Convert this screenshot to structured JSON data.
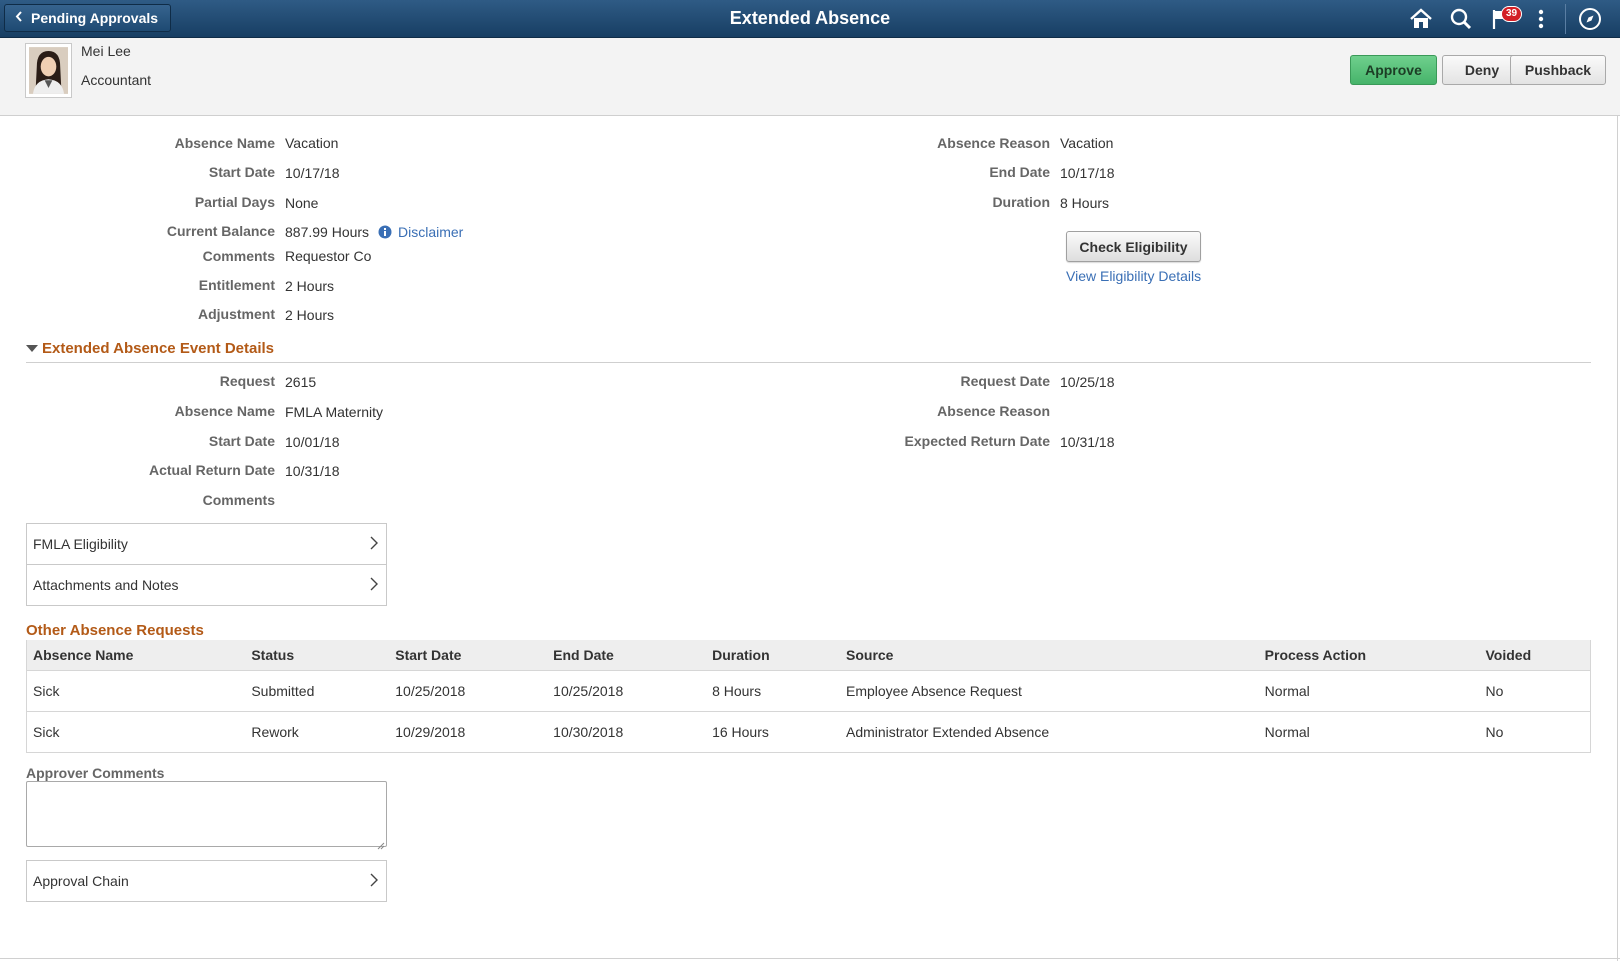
{
  "banner": {
    "back_label": "Pending Approvals",
    "title": "Extended Absence",
    "notification_count": "39",
    "icons": [
      "home-icon",
      "search-icon",
      "notification-flag-icon",
      "actions-menu-icon",
      "navbar-compass-icon"
    ]
  },
  "employee": {
    "name": "Mei Lee",
    "job_title": "Accountant"
  },
  "actions": {
    "approve": "Approve",
    "deny": "Deny",
    "pushback": "Pushback"
  },
  "summary": {
    "absence_name_label": "Absence Name",
    "absence_name": "Vacation",
    "start_date_label": "Start Date",
    "start_date": "10/17/18",
    "partial_days_label": "Partial Days",
    "partial_days": "None",
    "current_balance_label": "Current Balance",
    "current_balance": "887.99 Hours",
    "disclaimer": "Disclaimer",
    "comments_label": "Comments",
    "comments": "Requestor Co",
    "entitlement_label": "Entitlement",
    "entitlement": "2 Hours",
    "adjustment_label": "Adjustment",
    "adjustment": "2 Hours",
    "absence_reason_label": "Absence Reason",
    "absence_reason": "Vacation",
    "end_date_label": "End Date",
    "end_date": "10/17/18",
    "duration_label": "Duration",
    "duration": "8 Hours",
    "check_eligibility": "Check Eligibility",
    "view_eligibility": "View Eligibility Details"
  },
  "event": {
    "section_title": "Extended Absence Event Details",
    "request_label": "Request",
    "request": "2615",
    "absence_name_label": "Absence Name",
    "absence_name": "FMLA Maternity",
    "start_date_label": "Start Date",
    "start_date": "10/01/18",
    "actual_return_label": "Actual Return Date",
    "actual_return": "10/31/18",
    "comments_label": "Comments",
    "comments": "",
    "request_date_label": "Request Date",
    "request_date": "10/25/18",
    "absence_reason_label": "Absence Reason",
    "absence_reason": "",
    "expected_return_label": "Expected Return Date",
    "expected_return": "10/31/18"
  },
  "nav_items": {
    "fmla": "FMLA Eligibility",
    "attachments": "Attachments and Notes",
    "approval_chain": "Approval Chain"
  },
  "other_requests": {
    "title": "Other Absence Requests",
    "columns": [
      "Absence Name",
      "Status",
      "Start Date",
      "End Date",
      "Duration",
      "Source",
      "Process Action",
      "Voided"
    ],
    "rows": [
      [
        "Sick",
        "Submitted",
        "10/25/2018",
        "10/25/2018",
        "8 Hours",
        "Employee Absence Request",
        "Normal",
        "No"
      ],
      [
        "Sick",
        "Rework",
        "10/29/2018",
        "10/30/2018",
        "16 Hours",
        "Administrator Extended Absence",
        "Normal",
        "No"
      ]
    ]
  },
  "approver": {
    "comments_label": "Approver Comments",
    "comments_value": ""
  },
  "colors": {
    "banner": "#1e4a72",
    "approve": "#52bd73",
    "section_heading": "#b35a17",
    "link": "#3a6fb5"
  }
}
